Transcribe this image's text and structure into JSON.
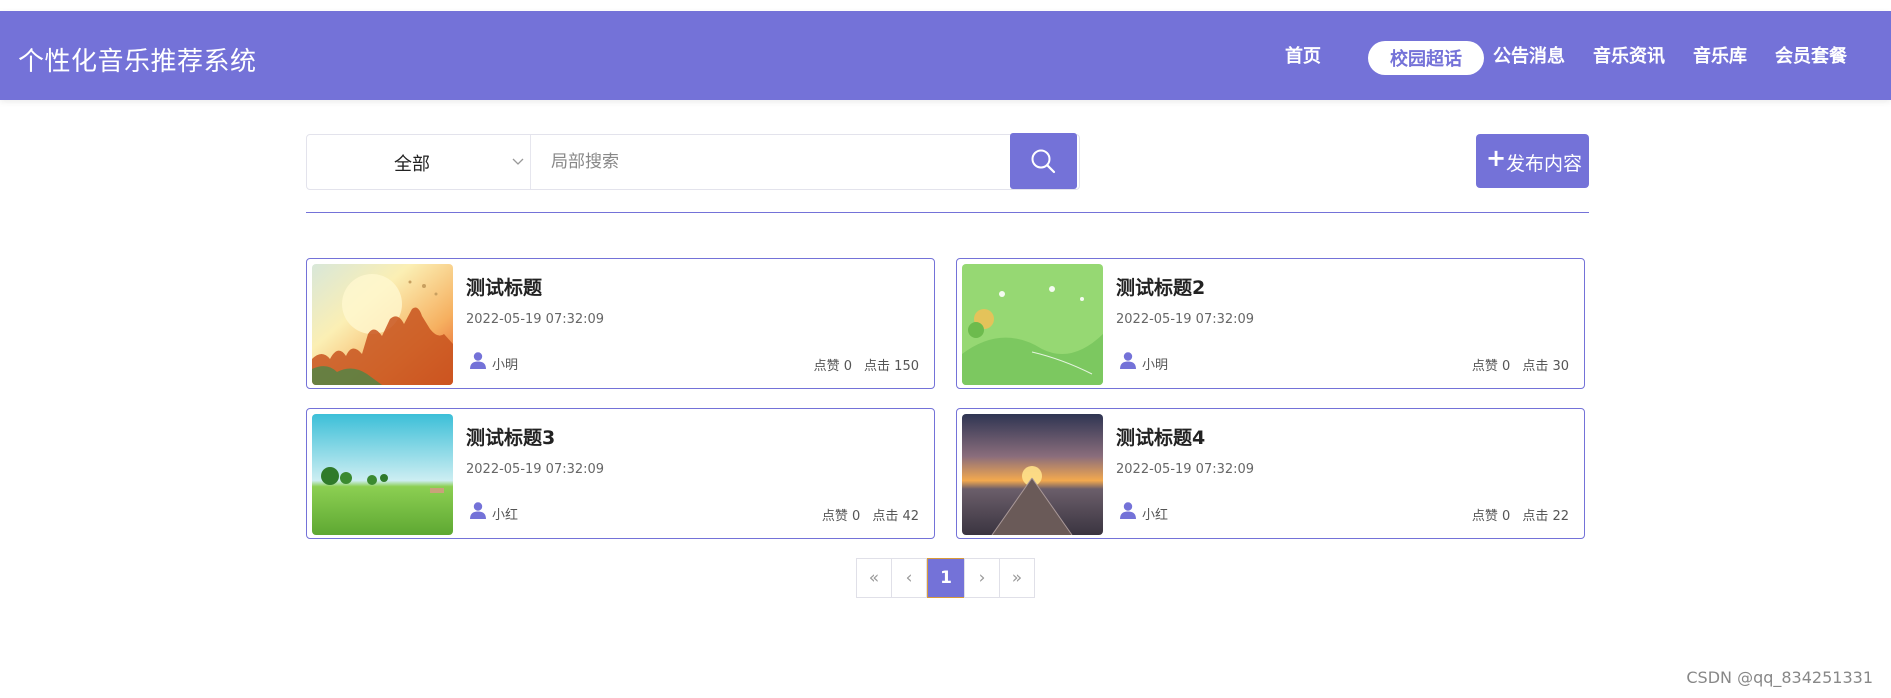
{
  "app": {
    "title": "个性化音乐推荐系统"
  },
  "nav": {
    "items": [
      {
        "label": "首页",
        "active": false
      },
      {
        "label": "校园超话",
        "active": true
      },
      {
        "label": "公告消息",
        "active": false
      },
      {
        "label": "音乐资讯",
        "active": false
      },
      {
        "label": "音乐库",
        "active": false
      },
      {
        "label": "会员套餐",
        "active": false
      }
    ]
  },
  "search": {
    "category": "全部",
    "placeholder": "局部搜索",
    "button_icon": "search-icon"
  },
  "publish": {
    "label": "发布内容",
    "icon": "plus-icon"
  },
  "posts": [
    {
      "title": "测试标题",
      "date": "2022-05-19 07:32:09",
      "author": "小明",
      "likes": "点赞 0",
      "clicks": "点击 150"
    },
    {
      "title": "测试标题2",
      "date": "2022-05-19 07:32:09",
      "author": "小明",
      "likes": "点赞 0",
      "clicks": "点击 30"
    },
    {
      "title": "测试标题3",
      "date": "2022-05-19 07:32:09",
      "author": "小红",
      "likes": "点赞 0",
      "clicks": "点击 42"
    },
    {
      "title": "测试标题4",
      "date": "2022-05-19 07:32:09",
      "author": "小红",
      "likes": "点赞 0",
      "clicks": "点击 22"
    }
  ],
  "pagination": {
    "first": "«",
    "prev": "‹",
    "current": "1",
    "next": "›",
    "last": "»"
  },
  "watermark": "CSDN @qq_834251331",
  "colors": {
    "accent": "#7472d8",
    "active_page_border": "#d99b3a"
  }
}
